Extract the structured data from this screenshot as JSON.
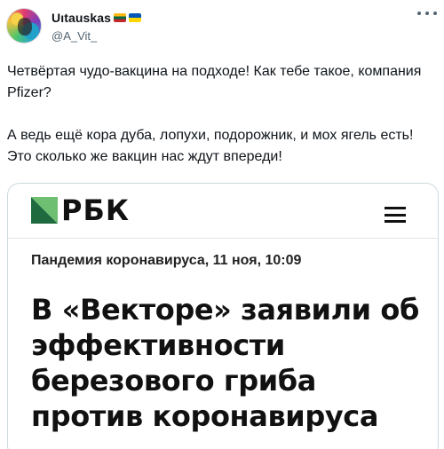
{
  "tweet": {
    "author": {
      "display_name": "Uıtauskas",
      "handle": "@A_Vit_",
      "flags": [
        "lithuania-flag-icon",
        "ukraine-flag-icon"
      ]
    },
    "text": [
      "Четвёртая чудо-вакцина на подходе! Как тебе такое, компания Pfizer?",
      "А ведь ещё кора дуба, лопухи, подорожник, и мох ягель есть! Это сколько же вакцин нас ждут впереди!"
    ],
    "more_icon": "more-dots-icon"
  },
  "media": {
    "brand": "РБК",
    "brand_colors": {
      "dark": "#1f6b3f",
      "light": "#6fbf73"
    },
    "menu_icon": "hamburger-menu-icon",
    "meta": "Пандемия коронавируса, 11 ноя, 10:09",
    "headline": "В «Векторе» заявили об эффективности березового гриба против коронавируса"
  }
}
